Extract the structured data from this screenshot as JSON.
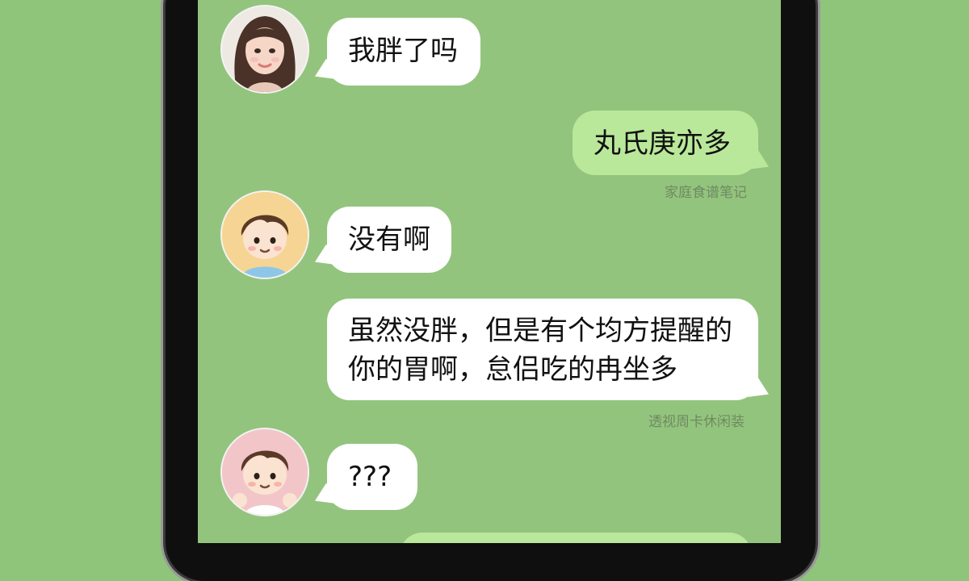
{
  "chat": {
    "messages": [
      {
        "text": "我胖了吗"
      },
      {
        "text": "丸氏庚亦多",
        "status": "家庭食谱笔记"
      },
      {
        "text": "没有啊"
      },
      {
        "text": "虽然没胖，但是有个均方提醒的\n你的胃啊，怠侣吃的冉坐多",
        "status": "透视周卡休闲装"
      },
      {
        "text": "???"
      }
    ]
  },
  "colors": {
    "background": "#8fc57a",
    "screen": "#93c47d",
    "sent_bubble": "#b9e89a",
    "received_bubble": "#ffffff"
  },
  "icons": [
    "girl-avatar",
    "boy-avatar",
    "boy-avatar-pink"
  ]
}
